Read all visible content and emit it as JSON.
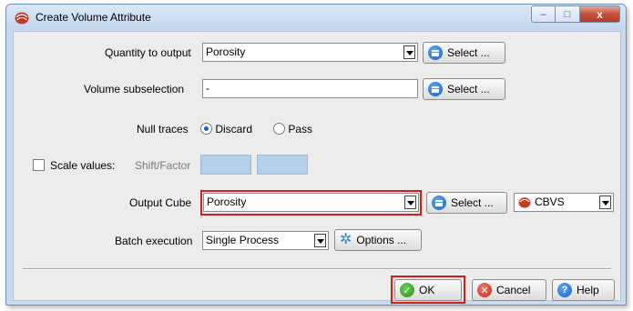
{
  "window": {
    "title": "Create Volume Attribute",
    "min_glyph": "–",
    "max_glyph": "□",
    "close_glyph": "x"
  },
  "quantity": {
    "label": "Quantity to output",
    "value": "Porosity",
    "select_label": "Select ..."
  },
  "volume_subselection": {
    "label": "Volume subselection",
    "value": "-",
    "select_label": "Select ..."
  },
  "null_traces": {
    "label": "Null traces",
    "options": [
      "Discard",
      "Pass"
    ],
    "selected": "Discard"
  },
  "scale_values": {
    "label": "Scale values:",
    "checked": false,
    "shift_factor_label": "Shift/Factor"
  },
  "output_cube": {
    "label": "Output Cube",
    "value": "Porosity",
    "select_label": "Select ...",
    "format_value": "CBVS"
  },
  "batch_execution": {
    "label": "Batch execution",
    "value": "Single Process",
    "options_label": "Options ..."
  },
  "footer": {
    "ok_label": "OK",
    "cancel_label": "Cancel",
    "help_label": "Help"
  },
  "colors": {
    "highlight": "#d61b1b",
    "accent_blue": "#1a62c4",
    "field_blue": "#b7d0ea"
  }
}
